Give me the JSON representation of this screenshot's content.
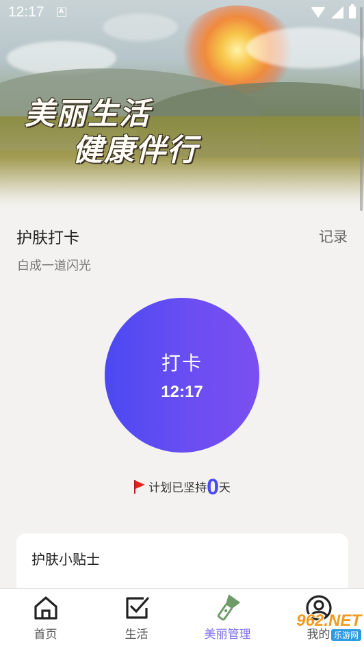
{
  "status_bar": {
    "time": "12:17",
    "notif_letter": "A"
  },
  "hero": {
    "slogan_line1": "美丽生活",
    "slogan_line2": "健康伴行"
  },
  "checkin": {
    "section_title": "护肤打卡",
    "record_label": "记录",
    "subtitle": "白成一道闪光",
    "button_label": "打卡",
    "button_time": "12:17",
    "streak_prefix": "计划已坚持",
    "streak_days": "0",
    "streak_suffix": "天",
    "accent_color": "#4b49f2"
  },
  "tips": {
    "title": "护肤小贴士"
  },
  "bottom_nav": {
    "items": [
      {
        "label": "首页",
        "icon": "home-icon"
      },
      {
        "label": "生活",
        "icon": "checkbox-icon"
      },
      {
        "label": "美丽管理",
        "icon": "flashlight-icon",
        "active": true
      },
      {
        "label": "我的",
        "icon": "profile-icon"
      }
    ],
    "active_color": "#7f6ff1"
  },
  "watermark": {
    "main": "962.NET",
    "sub": "乐游网"
  }
}
